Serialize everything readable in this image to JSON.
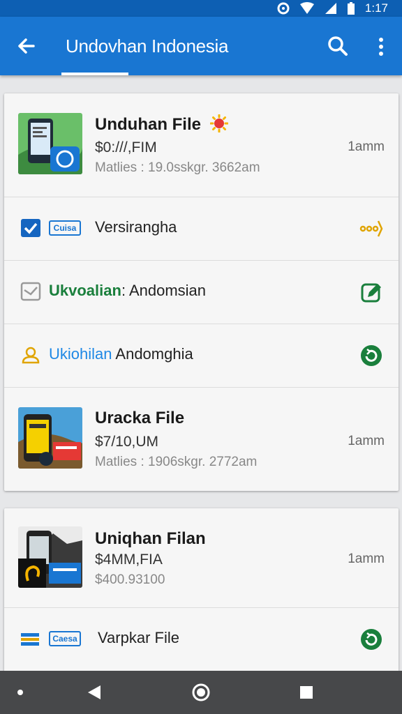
{
  "status_bar": {
    "time": "1:17"
  },
  "app_bar": {
    "title": "Undovhan Indonesia"
  },
  "cards": [
    {
      "file": {
        "name": "Unduhan File",
        "size": "$0:///,FIM",
        "meta": "Matlies : 19.0ssk​gr. 3662am",
        "time": "1amm"
      },
      "rows": [
        {
          "badge": "Cuisa",
          "label": "Versirangha"
        },
        {
          "accent": "Ukvoalian",
          "label": "Andomsian"
        },
        {
          "accent": "Ukiohilan",
          "label": "Andomghia"
        }
      ],
      "file2": {
        "name": "Uracka File",
        "size": "$7/10,UM",
        "meta": "Matlies : 1906skgr. 2772am",
        "time": "1amm"
      }
    },
    {
      "file": {
        "name": "Uniqhan Filan",
        "size": "$4MM,FIA",
        "meta": "$400.93100",
        "time": "1amm"
      },
      "row": {
        "badge": "Caesa",
        "label": "Varpkar File"
      }
    }
  ],
  "colors": {
    "app_bar": "#1976d2",
    "status_bar": "#0d5fb3",
    "accent_green": "#1a7f3c",
    "accent_blue": "#1e88e5",
    "accent_gold": "#e0a400"
  }
}
